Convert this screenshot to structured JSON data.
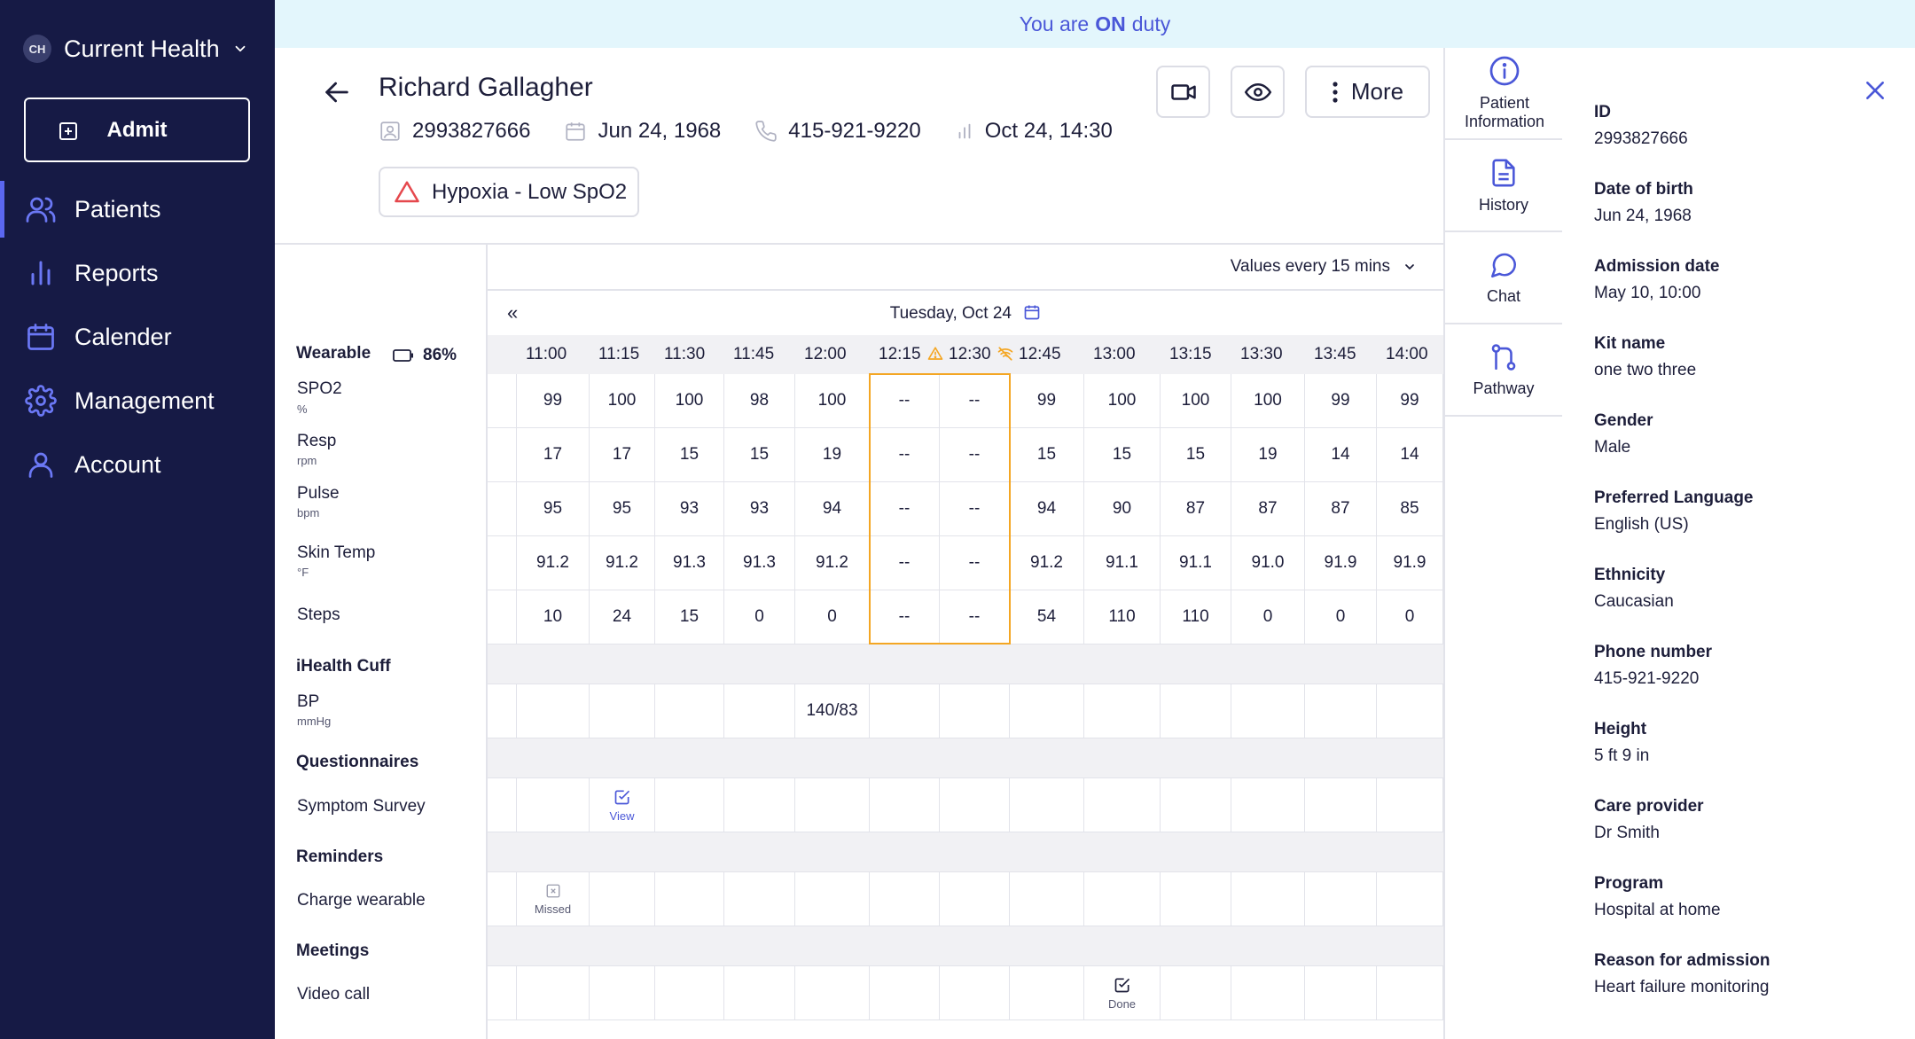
{
  "sidebar": {
    "org_initials": "CH",
    "org_name": "Current Health",
    "admit_label": "Admit",
    "items": [
      {
        "label": "Patients",
        "icon": "users-icon",
        "active": true
      },
      {
        "label": "Reports",
        "icon": "bar-chart-icon",
        "active": false
      },
      {
        "label": "Calender",
        "icon": "calendar-icon",
        "active": false
      },
      {
        "label": "Management",
        "icon": "gear-icon",
        "active": false
      },
      {
        "label": "Account",
        "icon": "user-icon",
        "active": false
      }
    ]
  },
  "banner": {
    "prefix": "You are",
    "status": "ON",
    "suffix": "duty"
  },
  "patient": {
    "name": "Richard Gallagher",
    "id": "2993827666",
    "dob": "Jun 24, 1968",
    "phone": "415-921-9220",
    "last_reading": "Oct 24, 14:30",
    "alert": "Hypoxia - Low SpO2"
  },
  "header_buttons": {
    "more_label": "More"
  },
  "grid": {
    "interval_label": "Values every 15 mins",
    "prev_label": "«",
    "day_label": "Tuesday, Oct 24",
    "times": [
      "11:00",
      "11:15",
      "11:30",
      "11:45",
      "12:00",
      "12:15",
      "12:30",
      "12:45",
      "13:00",
      "13:15",
      "13:30",
      "13:45",
      "14:00"
    ],
    "wearable": {
      "section": "Wearable",
      "battery": "86%"
    },
    "vitals": [
      {
        "label": "SPO2",
        "unit": "%",
        "values": [
          "99",
          "100",
          "100",
          "98",
          "100",
          "--",
          "--",
          "99",
          "100",
          "100",
          "100",
          "99",
          "99"
        ]
      },
      {
        "label": "Resp",
        "unit": "rpm",
        "values": [
          "17",
          "17",
          "15",
          "15",
          "19",
          "--",
          "--",
          "15",
          "15",
          "15",
          "19",
          "14",
          "14"
        ]
      },
      {
        "label": "Pulse",
        "unit": "bpm",
        "values": [
          "95",
          "95",
          "93",
          "93",
          "94",
          "--",
          "--",
          "94",
          "90",
          "87",
          "87",
          "87",
          "85"
        ]
      },
      {
        "label": "Skin Temp",
        "unit": "°F",
        "values": [
          "91.2",
          "91.2",
          "91.3",
          "91.3",
          "91.2",
          "--",
          "--",
          "91.2",
          "91.1",
          "91.1",
          "91.0",
          "91.9",
          "91.9"
        ]
      },
      {
        "label": "Steps",
        "unit": "",
        "values": [
          "10",
          "24",
          "15",
          "0",
          "0",
          "--",
          "--",
          "54",
          "110",
          "110",
          "0",
          "0",
          "0"
        ]
      }
    ],
    "ihealth": {
      "section": "iHealth Cuff",
      "label": "BP",
      "unit": "mmHg",
      "values": [
        "",
        "",
        "",
        "",
        "140/83",
        "",
        "",
        "",
        "",
        "",
        "",
        "",
        ""
      ]
    },
    "questionnaires": {
      "section": "Questionnaires",
      "label": "Symptom Survey",
      "action_label": "View"
    },
    "reminders": {
      "section": "Reminders",
      "label": "Charge wearable",
      "action_label": "Missed"
    },
    "meetings": {
      "section": "Meetings",
      "label": "Video call",
      "action_label": "Done"
    }
  },
  "right_panel": {
    "tabs": [
      {
        "label": "Patient Information",
        "icon": "info-icon"
      },
      {
        "label": "History",
        "icon": "document-icon"
      },
      {
        "label": "Chat",
        "icon": "chat-icon"
      },
      {
        "label": "Pathway",
        "icon": "pathway-icon"
      }
    ],
    "fields": [
      {
        "key": "ID",
        "value": "2993827666"
      },
      {
        "key": "Date of birth",
        "value": "Jun 24, 1968"
      },
      {
        "key": "Admission date",
        "value": "May 10, 10:00"
      },
      {
        "key": "Kit name",
        "value": "one two three"
      },
      {
        "key": "Gender",
        "value": "Male"
      },
      {
        "key": "Preferred Language",
        "value": "English (US)"
      },
      {
        "key": "Ethnicity",
        "value": "Caucasian"
      },
      {
        "key": "Phone number",
        "value": "415-921-9220"
      },
      {
        "key": "Height",
        "value": "5 ft 9 in"
      },
      {
        "key": "Care provider",
        "value": "Dr Smith"
      },
      {
        "key": "Program",
        "value": "Hospital at home"
      },
      {
        "key": "Reason for admission",
        "value": "Heart failure monitoring"
      }
    ]
  },
  "colors": {
    "sidebar_bg": "#161a45",
    "accent": "#4a57d8",
    "banner_bg": "#e3f6fc",
    "alert_red": "#e5484d",
    "highlight": "#f4a623"
  }
}
